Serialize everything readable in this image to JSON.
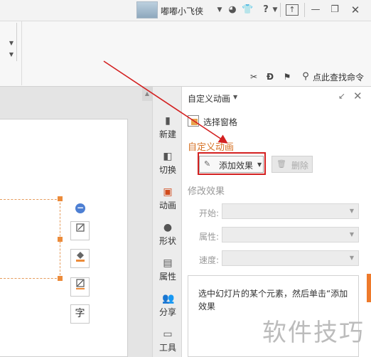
{
  "titlebar": {
    "user_name": "嘟嘟小飞侠",
    "icons": [
      "skin-icon",
      "shirt-icon",
      "help-icon",
      "upload-icon",
      "minimize-icon",
      "maximize-icon",
      "close-icon"
    ],
    "help_glyph": "?"
  },
  "ribbon": {
    "search_command": "点此查找命令"
  },
  "side_toolbar": {
    "items": [
      {
        "label": "新建",
        "icon": "new-doc-icon"
      },
      {
        "label": "切换",
        "icon": "transition-icon"
      },
      {
        "label": "动画",
        "icon": "animation-icon",
        "active": true
      },
      {
        "label": "形状",
        "icon": "shape-icon"
      },
      {
        "label": "属性",
        "icon": "properties-icon"
      },
      {
        "label": "分享",
        "icon": "share-icon"
      },
      {
        "label": "工具",
        "icon": "tools-icon"
      }
    ]
  },
  "pane": {
    "title": "自定义动画",
    "select_pane_label": "选择窗格",
    "custom_animation_heading": "自定义动画",
    "add_effect_label": "添加效果",
    "delete_label": "删除",
    "modify_heading": "修改效果",
    "start_label": "开始:",
    "property_label": "属性:",
    "speed_label": "速度:",
    "start_value": "",
    "property_value": "",
    "speed_value": "",
    "hint": "选中幻灯片的某个元素，然后单击“添加效果"
  },
  "canvas": {
    "float_buttons": [
      "crop-icon",
      "fill-icon",
      "line-style-icon",
      "text-wrap-icon"
    ],
    "text_wrap_glyph": "字"
  },
  "watermark": "软件技巧",
  "colors": {
    "accent_orange": "#d67225",
    "highlight_red": "#d32020",
    "handle_orange": "#ec8b3a",
    "blue_button": "#4d7fd3"
  }
}
